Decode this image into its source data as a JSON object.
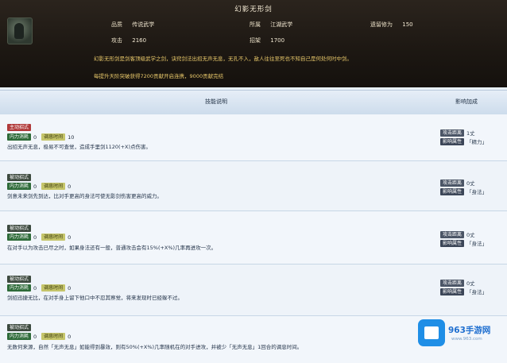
{
  "header": {
    "title": "幻影无形剑",
    "stats": {
      "grade_label": "品质",
      "grade_value": "传说武学",
      "school_label": "所属",
      "school_value": "江湖武学",
      "cultivation_label": "遗留修为",
      "cultivation_value": "150",
      "attack_label": "攻击",
      "attack_value": "2160",
      "hit_label": "招架",
      "hit_value": "1700"
    },
    "desc_line1": "幻影无形剑是剑客顶级武学之剑，诀窍剑法出招无声无息，无孔不入，敌人往往至死也不知自己是何处何时中剑。",
    "desc_line2": "每提升天阶突破获得7200贡献开启连携，9000贡献完结"
  },
  "table": {
    "col_skill": "技能说明",
    "col_effect": "影响加成"
  },
  "rows": [
    {
      "type_tag": "主动招式",
      "cost_label": "内力消耗",
      "cost_value": "0",
      "cd_label": "调息时间",
      "cd_value": "10",
      "text": "出招无声无息，极易不可查觉，造成手里剑1120(+X)点伤害。",
      "range_label": "攻击距离",
      "range_value": "1丈",
      "attr_label": "影响属性",
      "attr_value": "「精力」"
    },
    {
      "type_tag": "被动招式",
      "cost_label": "内力消耗",
      "cost_value": "0",
      "cd_label": "调息时间",
      "cd_value": "0",
      "text": "剑意未来剑先到达，比对手更高的身法可使无影剑伤害更高的威力。",
      "range_label": "攻击距离",
      "range_value": "0丈",
      "attr_label": "影响属性",
      "attr_value": "「身法」"
    },
    {
      "type_tag": "被动招式",
      "cost_label": "内力消耗",
      "cost_value": "0",
      "cd_label": "调息时间",
      "cd_value": "0",
      "text": "在对手以为攻击已尽之时，如果身法还有一般，普通攻击会有15%(+X%)几率再进攻一次。",
      "range_label": "攻击距离",
      "range_value": "0丈",
      "attr_label": "影响属性",
      "attr_value": "「身法」"
    },
    {
      "type_tag": "被动招式",
      "cost_label": "内力消耗",
      "cost_value": "0",
      "cd_label": "调息时间",
      "cd_value": "0",
      "text": "剑招迅捷无比，在对手身上留下他口中不忍其察觉，将来发现时已经躲不过。",
      "range_label": "攻击距离",
      "range_value": "0丈",
      "attr_label": "影响属性",
      "attr_value": "「身法」"
    },
    {
      "type_tag": "被动招式",
      "cost_label": "内力消耗",
      "cost_value": "0",
      "cd_label": "调息时间",
      "cd_value": "0",
      "text": "无数何来源，自然「无声无息」如能得到暴效，则有50%(+X%)几率随机在的对手进攻，并被少「无声无息」1回合的调息时间。",
      "range_label": "",
      "range_value": "",
      "attr_label": "",
      "attr_value": ""
    }
  ],
  "watermark": {
    "brand": "963手游网",
    "url": "www.963.com"
  }
}
